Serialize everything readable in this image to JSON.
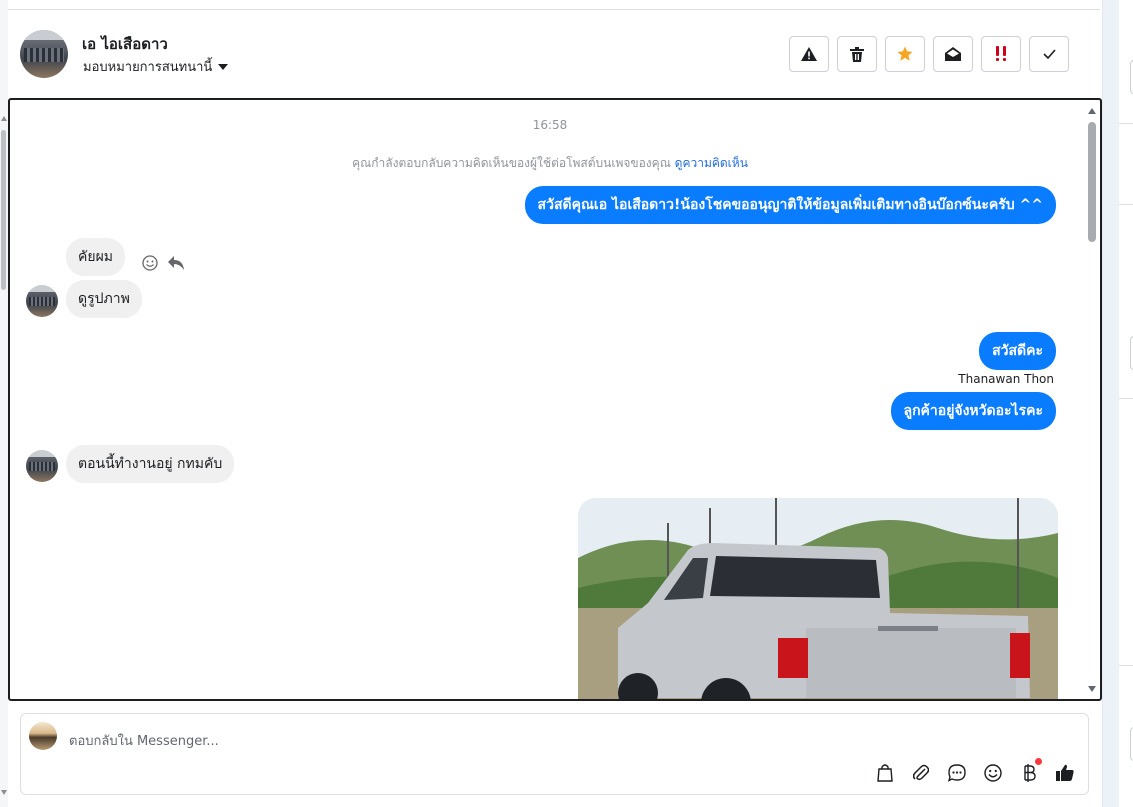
{
  "header": {
    "contact_name": "เอ ไอเสือดาว",
    "assign_label": "มอบหมายการสนทนานี้",
    "actions": [
      {
        "name": "spam-button",
        "icon": "warning-triangle-icon"
      },
      {
        "name": "delete-button",
        "icon": "trash-icon"
      },
      {
        "name": "star-button",
        "icon": "star-icon"
      },
      {
        "name": "mark-unread-button",
        "icon": "envelope-open-icon"
      },
      {
        "name": "follow-up-button",
        "icon": "exclamation-icon"
      },
      {
        "name": "done-button",
        "icon": "check-icon"
      }
    ],
    "star_color": "#f5a623",
    "followup_color": "#d0021b"
  },
  "conversation": {
    "timestamp": "16:58",
    "notice_text": "คุณกำลังตอบกลับความคิดเห็นของผู้ใช้ต่อโพสต์บนเพจของคุณ",
    "notice_link": "ดูความคิดเห็น",
    "messages": {
      "out_1": "สวัสดีคุณเอ ไอเสือดาว!น้องโชคขออนุญาติให้ข้อมูลเพิ่มเติมทางอินบ๊อกซ์นะครับ ^^",
      "in_1": "คัยผม",
      "in_2": "ดูรูปภาพ",
      "out_2": "สวัสดีคะ",
      "out_2_sender": "Thanawan Thon",
      "out_3": "ลูกค้าอยู่จังหวัดอะไรคะ",
      "in_3": "ตอนนี้ทำงานอยู่ กทมคับ"
    },
    "bubble_out_color": "#0a7cff",
    "bubble_in_color": "#f0f0f0"
  },
  "composer": {
    "placeholder": "ตอบกลับใน Messenger...",
    "tools": [
      "shopping-bag-icon",
      "paperclip-icon",
      "saved-reply-icon",
      "emoji-icon",
      "baht-icon",
      "thumbs-up-icon"
    ]
  }
}
